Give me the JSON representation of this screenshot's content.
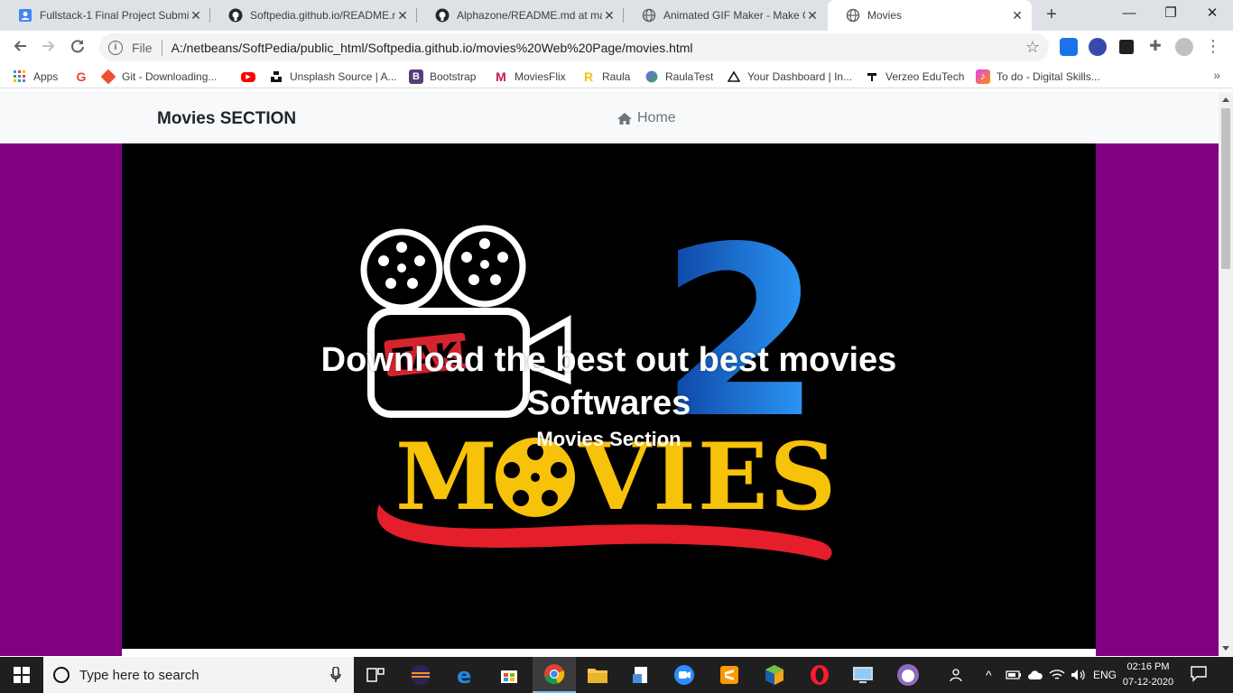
{
  "browser": {
    "tabs": [
      {
        "title": "Fullstack-1 Final Project Submi",
        "icon": "docs-icon",
        "color": "#4285f4",
        "active": false
      },
      {
        "title": "Softpedia.github.io/README.m",
        "icon": "github-icon",
        "color": "#24292e",
        "active": false
      },
      {
        "title": "Alphazone/README.md at ma",
        "icon": "github-icon",
        "color": "#24292e",
        "active": false
      },
      {
        "title": "Animated GIF Maker - Make G",
        "icon": "globe-icon",
        "color": "#5f6368",
        "active": false
      },
      {
        "title": "Movies",
        "icon": "globe-icon",
        "color": "#5f6368",
        "active": true
      }
    ],
    "address": {
      "scheme_label": "File",
      "url": "A:/netbeans/SoftPedia/public_html/Softpedia.github.io/movies%20Web%20Page/movies.html"
    },
    "bookmarks": [
      {
        "label": "Apps",
        "icon": "apps-grid-icon",
        "color": "#4285f4"
      },
      {
        "label": "",
        "icon": "google-icon",
        "color": "#ea4335"
      },
      {
        "label": "Git - Downloading...",
        "icon": "git-icon",
        "color": "#f05032"
      },
      {
        "label": "",
        "icon": "youtube-icon",
        "color": "#ff0000"
      },
      {
        "label": "Unsplash Source | A...",
        "icon": "unsplash-icon",
        "color": "#111111"
      },
      {
        "label": "Bootstrap",
        "icon": "bootstrap-icon",
        "color": "#563d7c"
      },
      {
        "label": "MoviesFlix",
        "icon": "moviesflix-icon",
        "color": "#c2185b"
      },
      {
        "label": "Raula",
        "icon": "raula-icon",
        "color": "#f4c20d"
      },
      {
        "label": "RaulaTest",
        "icon": "raulatest-icon",
        "color": "#7b61ff"
      },
      {
        "label": "Your Dashboard | In...",
        "icon": "dashboard-icon",
        "color": "#111111"
      },
      {
        "label": "Verzeo EduTech",
        "icon": "verzeo-icon",
        "color": "#111111"
      },
      {
        "label": "To do - Digital Skills...",
        "icon": "todo-icon",
        "color": "#e040fb"
      }
    ]
  },
  "page": {
    "brand": "Movies SECTION",
    "nav_home": "Home",
    "hero_title": "Download the best out best movies Softwares",
    "hero_subtitle": "Movies Section",
    "accent_bg": "#800080",
    "logo": {
      "badge_text": "TAKE",
      "number": "2",
      "word": "MOVIES"
    }
  },
  "taskbar": {
    "search_placeholder": "Type here to search",
    "language": "ENG",
    "time": "02:16 PM",
    "date": "07-12-2020",
    "apps": [
      "task-view-icon",
      "eclipse-icon",
      "edge-icon",
      "store-icon",
      "chrome-icon",
      "file-explorer-icon",
      "installer-icon",
      "zoom-icon",
      "sublime-icon",
      "virtualbox-icon",
      "opera-icon",
      "remote-desktop-icon",
      "cat-app-icon"
    ]
  }
}
